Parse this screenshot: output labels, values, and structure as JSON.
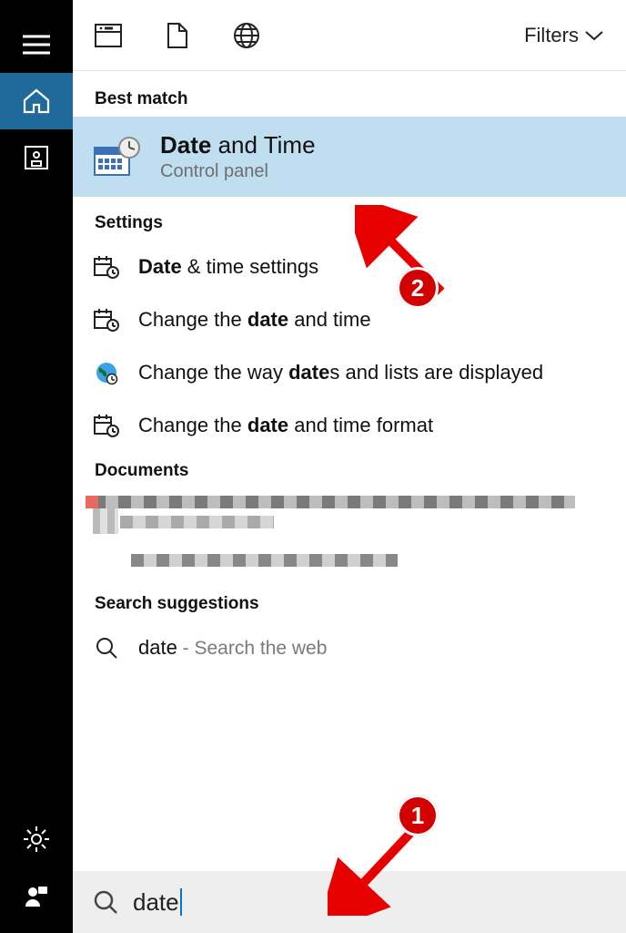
{
  "toolbar": {
    "filters_label": "Filters"
  },
  "sections": {
    "best_match": "Best match",
    "settings": "Settings",
    "documents": "Documents",
    "search_suggestions": "Search suggestions"
  },
  "best_match": {
    "title_pre": "Date",
    "title_post": " and Time",
    "subtitle": "Control panel"
  },
  "settings_rows": [
    {
      "pre": "Date",
      "post": " & time settings"
    },
    {
      "pre": "Change the ",
      "bold": "date",
      "post": " and time"
    },
    {
      "pre": "Change the way ",
      "bold": "date",
      "post": "s and lists are displayed"
    },
    {
      "pre": "Change the ",
      "bold": "date",
      "post": " and time format"
    }
  ],
  "search_suggestion": {
    "term": "date",
    "hint": " - Search the web"
  },
  "search_input": {
    "value": "date"
  },
  "annotations": {
    "badge1": "1",
    "badge2": "2"
  }
}
